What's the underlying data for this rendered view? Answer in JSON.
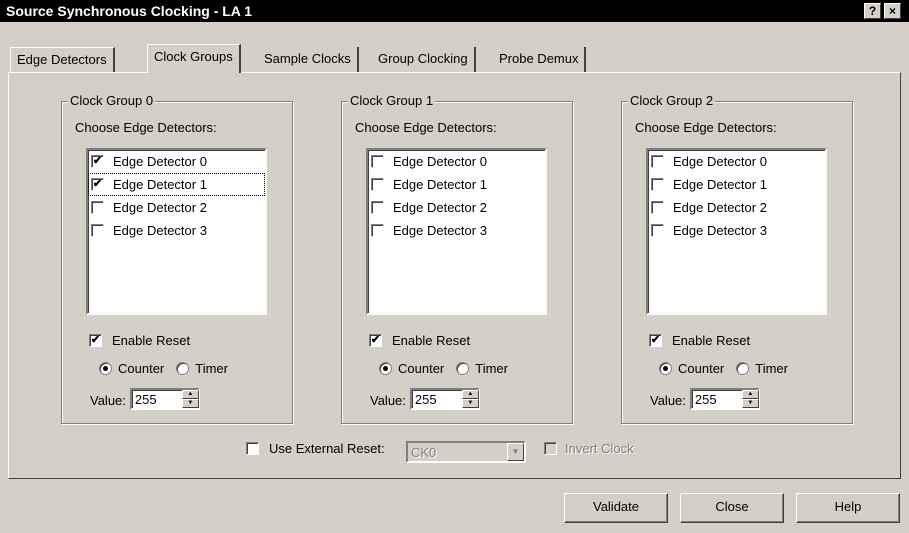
{
  "window": {
    "title": "Source Synchronous Clocking - LA 1",
    "help_button": "?",
    "close_button": "×"
  },
  "tabs": [
    {
      "label": "Edge Detectors"
    },
    {
      "label": "Clock Groups"
    },
    {
      "label": "Sample Clocks"
    },
    {
      "label": "Group Clocking"
    },
    {
      "label": "Probe Demux"
    }
  ],
  "groups": [
    {
      "title": "Clock Group 0",
      "choose_label": "Choose Edge Detectors:",
      "detectors": [
        {
          "label": "Edge Detector 0",
          "checked": true
        },
        {
          "label": "Edge Detector 1",
          "checked": true
        },
        {
          "label": "Edge Detector 2",
          "checked": false
        },
        {
          "label": "Edge Detector 3",
          "checked": false
        }
      ],
      "enable_reset_label": "Enable Reset",
      "enable_reset_checked": true,
      "counter_label": "Counter",
      "timer_label": "Timer",
      "mode": "Counter",
      "value_label": "Value:",
      "value": "255"
    },
    {
      "title": "Clock Group 1",
      "choose_label": "Choose Edge Detectors:",
      "detectors": [
        {
          "label": "Edge Detector 0",
          "checked": false
        },
        {
          "label": "Edge Detector 1",
          "checked": false
        },
        {
          "label": "Edge Detector 2",
          "checked": false
        },
        {
          "label": "Edge Detector 3",
          "checked": false
        }
      ],
      "enable_reset_label": "Enable Reset",
      "enable_reset_checked": true,
      "counter_label": "Counter",
      "timer_label": "Timer",
      "mode": "Counter",
      "value_label": "Value:",
      "value": "255"
    },
    {
      "title": "Clock Group 2",
      "choose_label": "Choose Edge Detectors:",
      "detectors": [
        {
          "label": "Edge Detector 0",
          "checked": false
        },
        {
          "label": "Edge Detector 1",
          "checked": false
        },
        {
          "label": "Edge Detector 2",
          "checked": false
        },
        {
          "label": "Edge Detector 3",
          "checked": false
        }
      ],
      "enable_reset_label": "Enable Reset",
      "enable_reset_checked": true,
      "counter_label": "Counter",
      "timer_label": "Timer",
      "mode": "Counter",
      "value_label": "Value:",
      "value": "255"
    }
  ],
  "external": {
    "use_external_reset_label": "Use External Reset:",
    "use_external_reset_checked": false,
    "external_reset_value": "CK0",
    "invert_clock_label": "Invert Clock",
    "invert_clock_checked": false
  },
  "buttons": {
    "validate": "Validate",
    "close": "Close",
    "help": "Help"
  },
  "icons": {
    "check": "✔",
    "spin_up": "▲",
    "spin_down": "▼",
    "dropdown": "▼"
  }
}
